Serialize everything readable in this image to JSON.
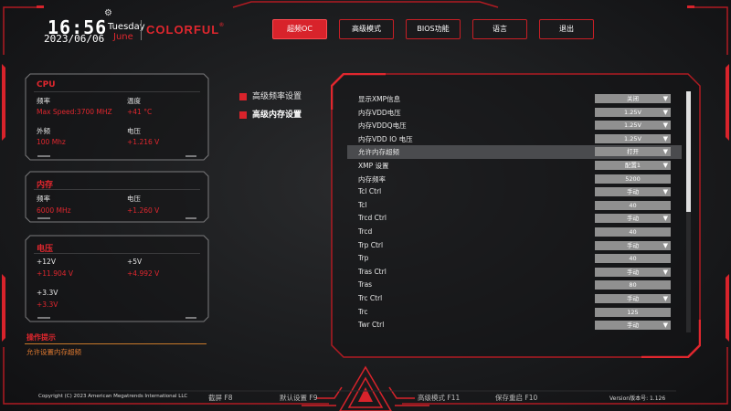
{
  "header": {
    "time": "16:56",
    "date": "2023/06/06",
    "weekday": "Tuesday",
    "month": "June",
    "brand": "COLORFUL",
    "brand_mark": "®"
  },
  "tabs": [
    {
      "label": "超频OC",
      "active": true
    },
    {
      "label": "高级模式",
      "active": false
    },
    {
      "label": "BIOS功能",
      "active": false
    },
    {
      "label": "语言",
      "active": false
    },
    {
      "label": "退出",
      "active": false
    }
  ],
  "cpu": {
    "title": "CPU",
    "freq_label": "频率",
    "freq_value": "Max Speed:3700 MHZ",
    "temp_label": "温度",
    "temp_value": "+41 °C",
    "ext_label": "外频",
    "ext_value": "100 Mhz",
    "volt_label": "电压",
    "volt_value": "+1.216 V"
  },
  "memory": {
    "title": "内存",
    "freq_label": "频率",
    "freq_value": "6000 MHz",
    "volt_label": "电压",
    "volt_value": "+1.260 V"
  },
  "voltage": {
    "title": "电压",
    "v12_label": "+12V",
    "v12_value": "+11.904 V",
    "v5_label": "+5V",
    "v5_value": "+4.992 V",
    "v33_label": "+3.3V",
    "v33_value": "+3.3V"
  },
  "hint": {
    "title": "操作提示",
    "text": "允许设置内存超频"
  },
  "menu": [
    {
      "label": "高级频率设置",
      "active": false
    },
    {
      "label": "高级内存设置",
      "active": true
    }
  ],
  "settings": [
    {
      "label": "显示XMP信息",
      "value": "关闭",
      "dropdown": true
    },
    {
      "label": "内存VDD电压",
      "value": "1.25V",
      "dropdown": true
    },
    {
      "label": "内存VDDQ电压",
      "value": "1.25V",
      "dropdown": true
    },
    {
      "label": "内存VDD IO 电压",
      "value": "1.25V",
      "dropdown": true
    },
    {
      "label": "允许内存超频",
      "value": "打开",
      "dropdown": true,
      "highlighted": true
    },
    {
      "label": "XMP 设置",
      "value": "配置1",
      "dropdown": true
    },
    {
      "label": "内存频率",
      "value": "5200",
      "dropdown": false
    },
    {
      "label": "Tcl Ctrl",
      "value": "手动",
      "dropdown": true
    },
    {
      "label": "Tcl",
      "value": "40",
      "dropdown": false
    },
    {
      "label": "Trcd Ctrl",
      "value": "手动",
      "dropdown": true
    },
    {
      "label": "Trcd",
      "value": "40",
      "dropdown": false
    },
    {
      "label": "Trp Ctrl",
      "value": "手动",
      "dropdown": true
    },
    {
      "label": "Trp",
      "value": "40",
      "dropdown": false
    },
    {
      "label": "Tras Ctrl",
      "value": "手动",
      "dropdown": true
    },
    {
      "label": "Tras",
      "value": "80",
      "dropdown": false
    },
    {
      "label": "Trc Ctrl",
      "value": "手动",
      "dropdown": true
    },
    {
      "label": "Trc",
      "value": "125",
      "dropdown": false
    },
    {
      "label": "Twr Ctrl",
      "value": "手动",
      "dropdown": true
    }
  ],
  "footer": {
    "copyright": "Copyright (C) 2023 American Megatrends International LLC",
    "keys": [
      "截屏 F8",
      "默认设置 F9",
      "高级模式 F11",
      "保存重启 F10"
    ],
    "version": "Version版本号: 1.126"
  },
  "icons": {
    "dropdown": "▼",
    "gear": "⚙"
  },
  "colors": {
    "accent": "#e0272e",
    "value_box": "#909090",
    "highlight_row": "#4a4b4e"
  }
}
